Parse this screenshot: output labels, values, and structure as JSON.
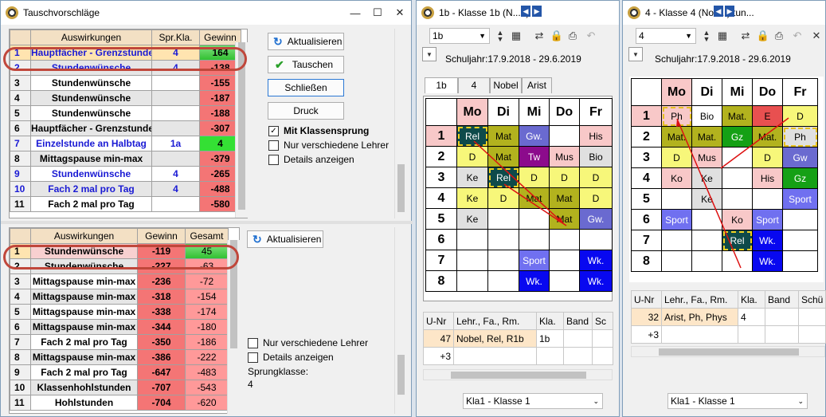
{
  "w1": {
    "title": "Tauschvorschläge"
  },
  "top": {
    "headers": [
      "Auswirkungen",
      "Spr.Kla.",
      "Gewinn"
    ],
    "rows": [
      {
        "n": "1",
        "a": "Hauptfächer - Grenzstunde",
        "s": "4",
        "g": "164"
      },
      {
        "n": "2",
        "a": "Stundenwünsche",
        "s": "4",
        "g": "-138"
      },
      {
        "n": "3",
        "a": "Stundenwünsche",
        "s": "",
        "g": "-155"
      },
      {
        "n": "4",
        "a": "Stundenwünsche",
        "s": "",
        "g": "-187"
      },
      {
        "n": "5",
        "a": "Stundenwünsche",
        "s": "",
        "g": "-188"
      },
      {
        "n": "6",
        "a": "Hauptfächer - Grenzstunde",
        "s": "",
        "g": "-307"
      },
      {
        "n": "7",
        "a": "Einzelstunde an Halbtag",
        "s": "1a",
        "g": "4"
      },
      {
        "n": "8",
        "a": "Mittagspause min-max",
        "s": "",
        "g": "-379"
      },
      {
        "n": "9",
        "a": "Stundenwünsche",
        "s": "4",
        "g": "-265"
      },
      {
        "n": "10",
        "a": "Fach 2 mal pro Tag",
        "s": "4",
        "g": "-488"
      },
      {
        "n": "11",
        "a": "Fach 2 mal pro Tag",
        "s": "",
        "g": "-580"
      }
    ]
  },
  "buttons": {
    "aktualisieren": "Aktualisieren",
    "tauschen": "Tauschen",
    "schliessen": "Schließen",
    "druck": "Druck",
    "aktualisieren2": "Aktualisieren"
  },
  "checks": {
    "klassensprung": "Mit Klassensprung",
    "verschiedene": "Nur verschiedene Lehrer",
    "details": "Details anzeigen",
    "verschiedene2": "Nur verschiedene Lehrer",
    "details2": "Details anzeigen"
  },
  "sprungklasse": {
    "label": "Sprungklasse:",
    "value": "4"
  },
  "bottom": {
    "headers": [
      "Auswirkungen",
      "Gewinn",
      "Gesamt"
    ],
    "rows": [
      {
        "n": "1",
        "a": "Stundenwünsche",
        "g": "-119",
        "t": "45"
      },
      {
        "n": "2",
        "a": "Stundenwünsche",
        "g": "-227",
        "t": "-63"
      },
      {
        "n": "3",
        "a": "Mittagspause min-max",
        "g": "-236",
        "t": "-72"
      },
      {
        "n": "4",
        "a": "Mittagspause min-max",
        "g": "-318",
        "t": "-154"
      },
      {
        "n": "5",
        "a": "Mittagspause min-max",
        "g": "-338",
        "t": "-174"
      },
      {
        "n": "6",
        "a": "Mittagspause min-max",
        "g": "-344",
        "t": "-180"
      },
      {
        "n": "7",
        "a": "Fach 2 mal pro Tag",
        "g": "-350",
        "t": "-186"
      },
      {
        "n": "8",
        "a": "Mittagspause min-max",
        "g": "-386",
        "t": "-222"
      },
      {
        "n": "9",
        "a": "Fach 2 mal pro Tag",
        "g": "-647",
        "t": "-483"
      },
      {
        "n": "10",
        "a": "Klassenhohlstunden",
        "g": "-707",
        "t": "-543"
      },
      {
        "n": "11",
        "a": "Hohlstunden",
        "g": "-704",
        "t": "-620"
      }
    ]
  },
  "w2": {
    "title": "1b - Klasse 1b (N...n)  ...",
    "combo": "1b",
    "schuljahr": "Schuljahr:17.9.2018 - 29.6.2019",
    "tabs": [
      "1b",
      "4",
      "Nobel",
      "Arist"
    ],
    "days": [
      "Mo",
      "Di",
      "Mi",
      "Do",
      "Fr"
    ],
    "rows": [
      [
        "Rel",
        "Mat",
        "Gw.",
        "",
        "His"
      ],
      [
        "D",
        "Mat",
        "Tw",
        "Mus",
        "Bio"
      ],
      [
        "Ke",
        "Rel",
        "D",
        "D",
        "D"
      ],
      [
        "Ke",
        "D",
        "Mat",
        "Mat",
        "D"
      ],
      [
        "Ke",
        "",
        "",
        "Mat",
        "Gw."
      ],
      [
        "",
        "",
        "",
        "",
        ""
      ],
      [
        "",
        "",
        "Sport",
        "",
        "Wk."
      ],
      [
        "",
        "",
        "Wk.",
        "",
        "Wk."
      ]
    ],
    "periods": [
      "1",
      "2",
      "3",
      "4",
      "5",
      "6",
      "7",
      "8"
    ],
    "ut": {
      "headers": [
        "U-Nr",
        "Lehr., Fa., Rm.",
        "Kla.",
        "Band",
        "Sc"
      ],
      "row": [
        "47",
        "Nobel, Rel, R1b",
        "1b",
        "",
        ""
      ],
      "more": "+3"
    },
    "footer": "Kla1 - Klasse 1"
  },
  "w3": {
    "title": "4 - Klasse 4 (Nob...)  tun...",
    "combo": "4",
    "schuljahr": "Schuljahr:17.9.2018 - 29.6.2019",
    "days": [
      "Mo",
      "Di",
      "Mi",
      "Do",
      "Fr"
    ],
    "rows": [
      [
        "Ph",
        "Bio",
        "Mat.",
        "E",
        "D"
      ],
      [
        "Mat.",
        "Mat.",
        "Gz",
        "Mat.",
        "Ph"
      ],
      [
        "D",
        "Mus",
        "",
        "D",
        "Gw"
      ],
      [
        "Ko",
        "Ke",
        "",
        "His",
        "Gz"
      ],
      [
        "",
        "Ke",
        "",
        "",
        "Sport"
      ],
      [
        "Sport",
        "",
        "Ko",
        "Sport",
        ""
      ],
      [
        "",
        "",
        "Rel",
        "Wk.",
        ""
      ],
      [
        "",
        "",
        "",
        "Wk.",
        ""
      ]
    ],
    "periods": [
      "1",
      "2",
      "3",
      "4",
      "5",
      "6",
      "7",
      "8"
    ],
    "ut": {
      "headers": [
        "U-Nr",
        "Lehr., Fa., Rm.",
        "Kla.",
        "Band",
        "Schü"
      ],
      "row": [
        "32",
        "Arist, Ph, Phys",
        "4",
        "",
        ""
      ],
      "more": "+3"
    },
    "footer": "Kla1 - Klasse 1"
  },
  "icons": [
    "app-icon",
    "refresh-icon",
    "checkmark-icon",
    "close-icon",
    "maximize-icon",
    "minimize-icon",
    "lock-icon",
    "print-icon",
    "undo-icon",
    "spinner-icon"
  ]
}
